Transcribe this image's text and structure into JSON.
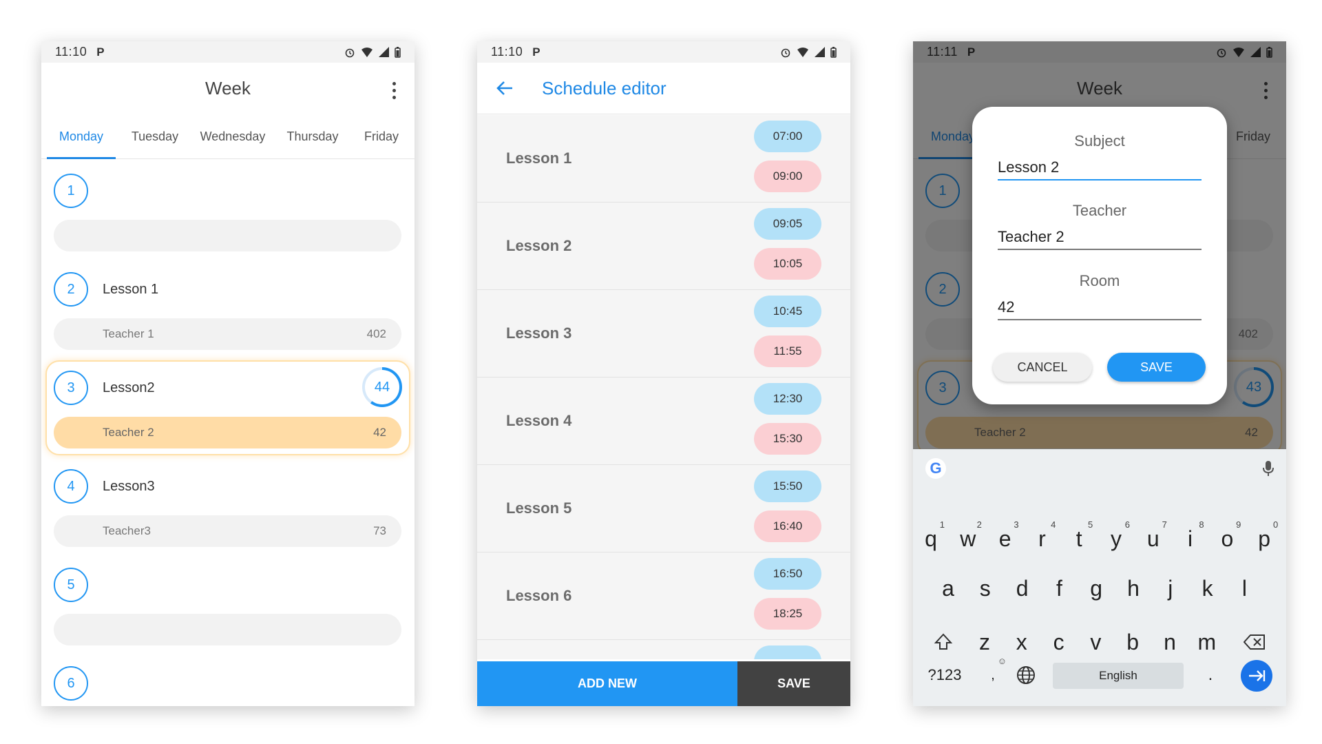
{
  "status": {
    "time1": "11:10",
    "time2": "11:10",
    "time3": "11:11",
    "notif": "P"
  },
  "week": {
    "title": "Week",
    "tabs": [
      "Monday",
      "Tuesday",
      "Wednesday",
      "Thursday",
      "Friday"
    ],
    "lessons": [
      {
        "num": "1",
        "name": "",
        "teacher": "",
        "room": ""
      },
      {
        "num": "2",
        "name": "Lesson 1",
        "teacher": "Teacher 1",
        "room": "402"
      },
      {
        "num": "3",
        "name": "Lesson2",
        "teacher": "Teacher 2",
        "room": "42",
        "progress": "44"
      },
      {
        "num": "4",
        "name": "Lesson3",
        "teacher": "Teacher3",
        "room": "73"
      },
      {
        "num": "5",
        "name": "",
        "teacher": "",
        "room": ""
      },
      {
        "num": "6",
        "name": "",
        "teacher": "",
        "room": ""
      }
    ]
  },
  "editor": {
    "title": "Schedule editor",
    "rows": [
      {
        "name": "Lesson 1",
        "start": "07:00",
        "end": "09:00"
      },
      {
        "name": "Lesson 2",
        "start": "09:05",
        "end": "10:05"
      },
      {
        "name": "Lesson 3",
        "start": "10:45",
        "end": "11:55"
      },
      {
        "name": "Lesson 4",
        "start": "12:30",
        "end": "15:30"
      },
      {
        "name": "Lesson 5",
        "start": "15:50",
        "end": "16:40"
      },
      {
        "name": "Lesson 6",
        "start": "16:50",
        "end": "18:25"
      }
    ],
    "add_new": "ADD NEW",
    "save": "SAVE"
  },
  "dialog": {
    "subject_label": "Subject",
    "subject_value": "Lesson 2",
    "teacher_label": "Teacher",
    "teacher_value": "Teacher 2",
    "room_label": "Room",
    "room_value": "42",
    "cancel": "CANCEL",
    "save": "SAVE"
  },
  "behind": {
    "tab_monday": "Monday",
    "tab_friday": "Friday",
    "n1": "1",
    "n2": "2",
    "n3": "3",
    "room": "402",
    "progress": "43",
    "teacher": "Teacher 2",
    "room2": "42"
  },
  "keyboard": {
    "row1": [
      {
        "k": "q",
        "n": "1"
      },
      {
        "k": "w",
        "n": "2"
      },
      {
        "k": "e",
        "n": "3"
      },
      {
        "k": "r",
        "n": "4"
      },
      {
        "k": "t",
        "n": "5"
      },
      {
        "k": "y",
        "n": "6"
      },
      {
        "k": "u",
        "n": "7"
      },
      {
        "k": "i",
        "n": "8"
      },
      {
        "k": "o",
        "n": "9"
      },
      {
        "k": "p",
        "n": "0"
      }
    ],
    "row2": [
      "a",
      "s",
      "d",
      "f",
      "g",
      "h",
      "j",
      "k",
      "l"
    ],
    "row3": [
      "z",
      "x",
      "c",
      "v",
      "b",
      "n",
      "m"
    ],
    "sym": "?123",
    "space": "English",
    "period": ".",
    "comma": ","
  },
  "colors": {
    "accent": "#2196f3",
    "start_pill": "#b3e1f8",
    "end_pill": "#fbcfd3",
    "highlight": "#ffdca6"
  }
}
